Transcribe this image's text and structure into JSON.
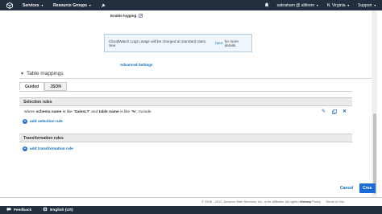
{
  "nav": {
    "services": "Services",
    "resource_groups": "Resource Groups",
    "user": "sabraham @ altitrem",
    "region": "N. Virginia",
    "support": "Support"
  },
  "logging": {
    "enable_label": "Enable logging",
    "checked": true
  },
  "info": {
    "text_before": "CloudWatch Logs usage will be charged at standard rates. See",
    "link": "here",
    "text_after": "for more details."
  },
  "advanced_settings": "Advanced Settings",
  "table_mappings": {
    "title": "Table mappings",
    "tabs": [
      "Guided",
      "JSON"
    ],
    "active_tab": "Guided",
    "selection_rules_title": "Selection rules",
    "rule": {
      "prefix": "where",
      "schema_label": "schema name",
      "mid1": "is like",
      "schema_value": "'SalesLT'",
      "and": "and",
      "table_label": "table name",
      "mid2": "is like",
      "table_value": "'%'",
      "comma": ",",
      "action": "Include"
    },
    "add_selection_rule": "add selection rule",
    "transformation_rules_title": "Transformation rules",
    "add_transformation_rule": "add transformation rule"
  },
  "buttons": {
    "cancel": "Cancel",
    "create": "Crea"
  },
  "footer": {
    "copyright": "© 2008 - 2017, Amazon Web Services, Inc. or its affiliates. All rights reserved.",
    "privacy": "Privacy Policy",
    "terms": "Terms of Use",
    "feedback": "Feedback",
    "language": "English (US)"
  },
  "colors": {
    "nav_bg": "#232f3e",
    "link": "#0a6ebd",
    "primary": "#1a6dd6"
  }
}
